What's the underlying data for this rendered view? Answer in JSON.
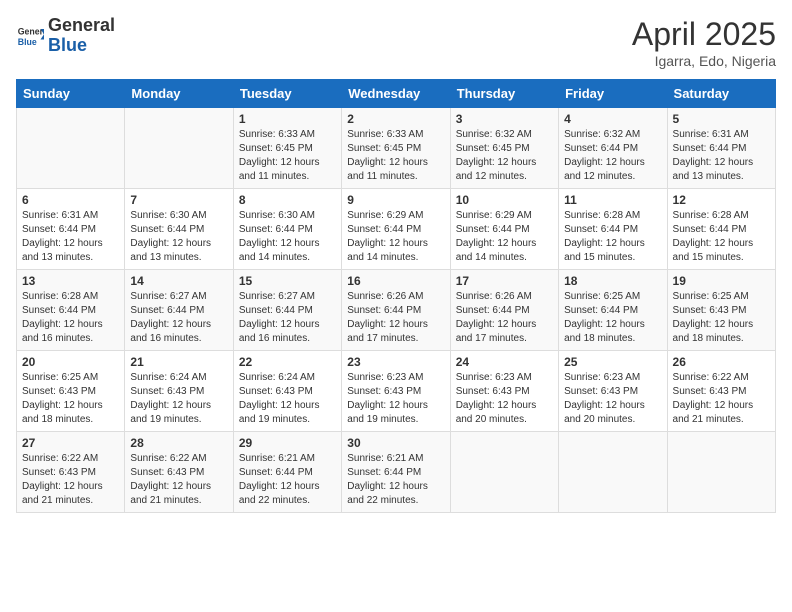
{
  "logo": {
    "general": "General",
    "blue": "Blue"
  },
  "title": {
    "month": "April 2025",
    "location": "Igarra, Edo, Nigeria"
  },
  "weekdays": [
    "Sunday",
    "Monday",
    "Tuesday",
    "Wednesday",
    "Thursday",
    "Friday",
    "Saturday"
  ],
  "weeks": [
    [
      {
        "day": null,
        "info": null
      },
      {
        "day": null,
        "info": null
      },
      {
        "day": "1",
        "sunrise": "6:33 AM",
        "sunset": "6:45 PM",
        "daylight": "12 hours and 11 minutes."
      },
      {
        "day": "2",
        "sunrise": "6:33 AM",
        "sunset": "6:45 PM",
        "daylight": "12 hours and 11 minutes."
      },
      {
        "day": "3",
        "sunrise": "6:32 AM",
        "sunset": "6:45 PM",
        "daylight": "12 hours and 12 minutes."
      },
      {
        "day": "4",
        "sunrise": "6:32 AM",
        "sunset": "6:44 PM",
        "daylight": "12 hours and 12 minutes."
      },
      {
        "day": "5",
        "sunrise": "6:31 AM",
        "sunset": "6:44 PM",
        "daylight": "12 hours and 13 minutes."
      }
    ],
    [
      {
        "day": "6",
        "sunrise": "6:31 AM",
        "sunset": "6:44 PM",
        "daylight": "12 hours and 13 minutes."
      },
      {
        "day": "7",
        "sunrise": "6:30 AM",
        "sunset": "6:44 PM",
        "daylight": "12 hours and 13 minutes."
      },
      {
        "day": "8",
        "sunrise": "6:30 AM",
        "sunset": "6:44 PM",
        "daylight": "12 hours and 14 minutes."
      },
      {
        "day": "9",
        "sunrise": "6:29 AM",
        "sunset": "6:44 PM",
        "daylight": "12 hours and 14 minutes."
      },
      {
        "day": "10",
        "sunrise": "6:29 AM",
        "sunset": "6:44 PM",
        "daylight": "12 hours and 14 minutes."
      },
      {
        "day": "11",
        "sunrise": "6:28 AM",
        "sunset": "6:44 PM",
        "daylight": "12 hours and 15 minutes."
      },
      {
        "day": "12",
        "sunrise": "6:28 AM",
        "sunset": "6:44 PM",
        "daylight": "12 hours and 15 minutes."
      }
    ],
    [
      {
        "day": "13",
        "sunrise": "6:28 AM",
        "sunset": "6:44 PM",
        "daylight": "12 hours and 16 minutes."
      },
      {
        "day": "14",
        "sunrise": "6:27 AM",
        "sunset": "6:44 PM",
        "daylight": "12 hours and 16 minutes."
      },
      {
        "day": "15",
        "sunrise": "6:27 AM",
        "sunset": "6:44 PM",
        "daylight": "12 hours and 16 minutes."
      },
      {
        "day": "16",
        "sunrise": "6:26 AM",
        "sunset": "6:44 PM",
        "daylight": "12 hours and 17 minutes."
      },
      {
        "day": "17",
        "sunrise": "6:26 AM",
        "sunset": "6:44 PM",
        "daylight": "12 hours and 17 minutes."
      },
      {
        "day": "18",
        "sunrise": "6:25 AM",
        "sunset": "6:44 PM",
        "daylight": "12 hours and 18 minutes."
      },
      {
        "day": "19",
        "sunrise": "6:25 AM",
        "sunset": "6:43 PM",
        "daylight": "12 hours and 18 minutes."
      }
    ],
    [
      {
        "day": "20",
        "sunrise": "6:25 AM",
        "sunset": "6:43 PM",
        "daylight": "12 hours and 18 minutes."
      },
      {
        "day": "21",
        "sunrise": "6:24 AM",
        "sunset": "6:43 PM",
        "daylight": "12 hours and 19 minutes."
      },
      {
        "day": "22",
        "sunrise": "6:24 AM",
        "sunset": "6:43 PM",
        "daylight": "12 hours and 19 minutes."
      },
      {
        "day": "23",
        "sunrise": "6:23 AM",
        "sunset": "6:43 PM",
        "daylight": "12 hours and 19 minutes."
      },
      {
        "day": "24",
        "sunrise": "6:23 AM",
        "sunset": "6:43 PM",
        "daylight": "12 hours and 20 minutes."
      },
      {
        "day": "25",
        "sunrise": "6:23 AM",
        "sunset": "6:43 PM",
        "daylight": "12 hours and 20 minutes."
      },
      {
        "day": "26",
        "sunrise": "6:22 AM",
        "sunset": "6:43 PM",
        "daylight": "12 hours and 21 minutes."
      }
    ],
    [
      {
        "day": "27",
        "sunrise": "6:22 AM",
        "sunset": "6:43 PM",
        "daylight": "12 hours and 21 minutes."
      },
      {
        "day": "28",
        "sunrise": "6:22 AM",
        "sunset": "6:43 PM",
        "daylight": "12 hours and 21 minutes."
      },
      {
        "day": "29",
        "sunrise": "6:21 AM",
        "sunset": "6:44 PM",
        "daylight": "12 hours and 22 minutes."
      },
      {
        "day": "30",
        "sunrise": "6:21 AM",
        "sunset": "6:44 PM",
        "daylight": "12 hours and 22 minutes."
      },
      {
        "day": null,
        "info": null
      },
      {
        "day": null,
        "info": null
      },
      {
        "day": null,
        "info": null
      }
    ]
  ]
}
